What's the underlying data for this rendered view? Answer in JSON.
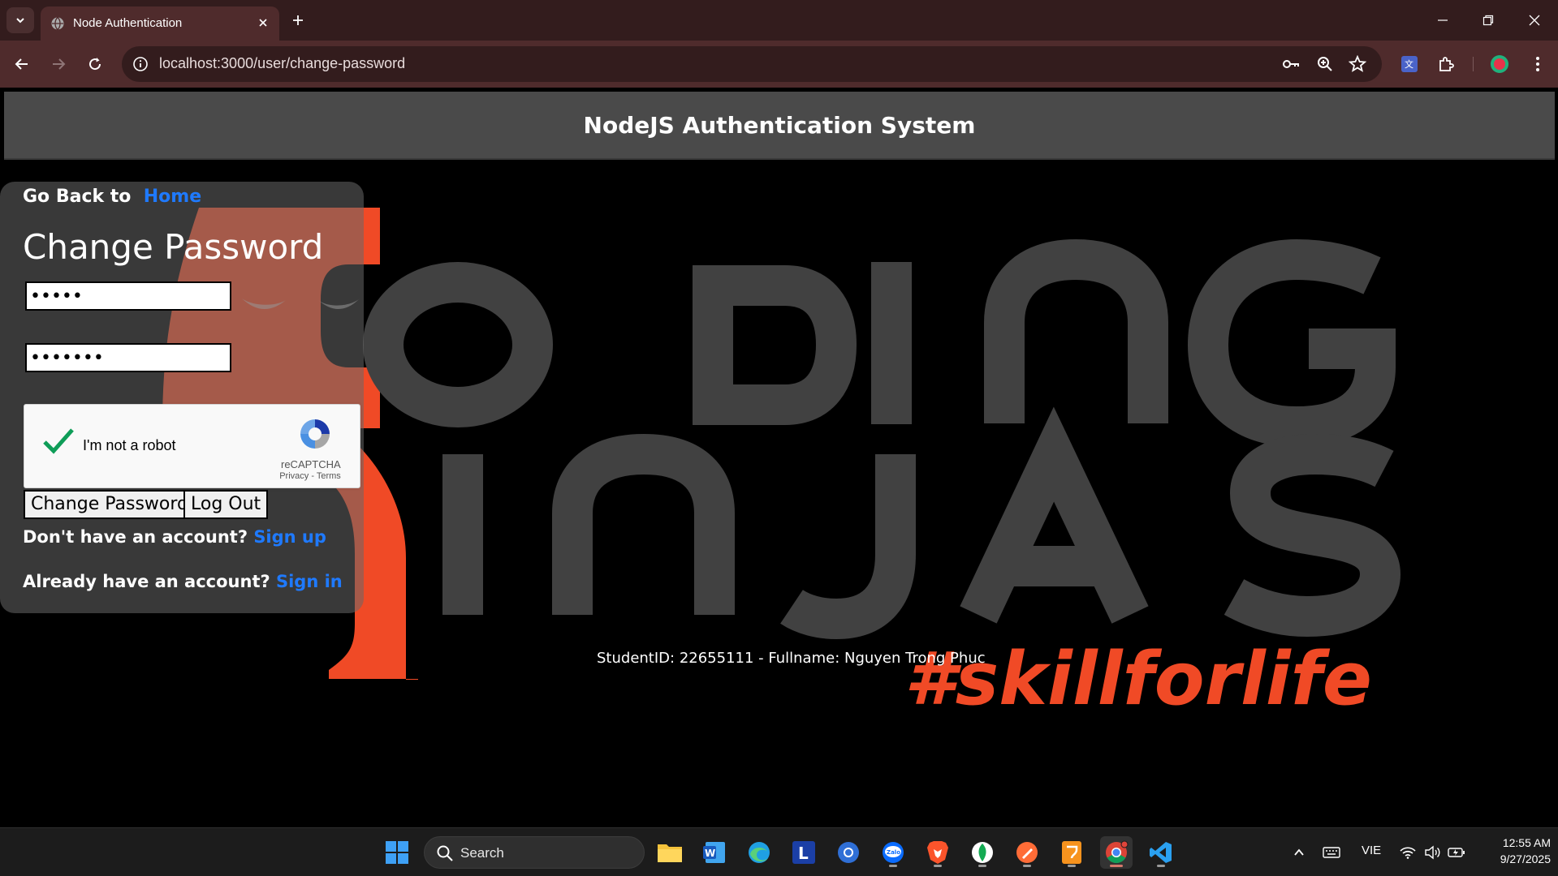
{
  "browser": {
    "tab_title": "Node Authentication",
    "url": "localhost:3000/user/change-password"
  },
  "page": {
    "site_title": "NodeJS Authentication System",
    "go_back_text": "Go Back to",
    "go_back_link": "Home",
    "form_title": "Change Password",
    "password_mask_1": "•••••",
    "password_mask_2": "•••••••",
    "captcha": {
      "label": "I'm not a robot",
      "brand": "reCAPTCHA",
      "links": "Privacy - Terms"
    },
    "change_password_button": "Change Password",
    "logout_button": "Log Out",
    "signup_prompt": "Don't have an account?",
    "signup_link": "Sign up",
    "signin_prompt": "Already have an account?",
    "signin_link": "Sign in",
    "student_info": "StudentID: 22655111 - Fullname: Nguyen Trong Phuc",
    "background_text": {
      "line1": "ODING",
      "line2": "INJAS",
      "hashtag": "#skillforlife"
    }
  },
  "taskbar": {
    "search_label": "Search",
    "language": "VIE",
    "time": "12:55 AM",
    "date": "9/27/2025"
  },
  "colors": {
    "chrome_dark": "#331c1d",
    "chrome_toolbar": "#4f2b2c",
    "link_blue": "#1f7aff",
    "brand_orange": "#f04a26",
    "bg_letters": "#414141"
  }
}
